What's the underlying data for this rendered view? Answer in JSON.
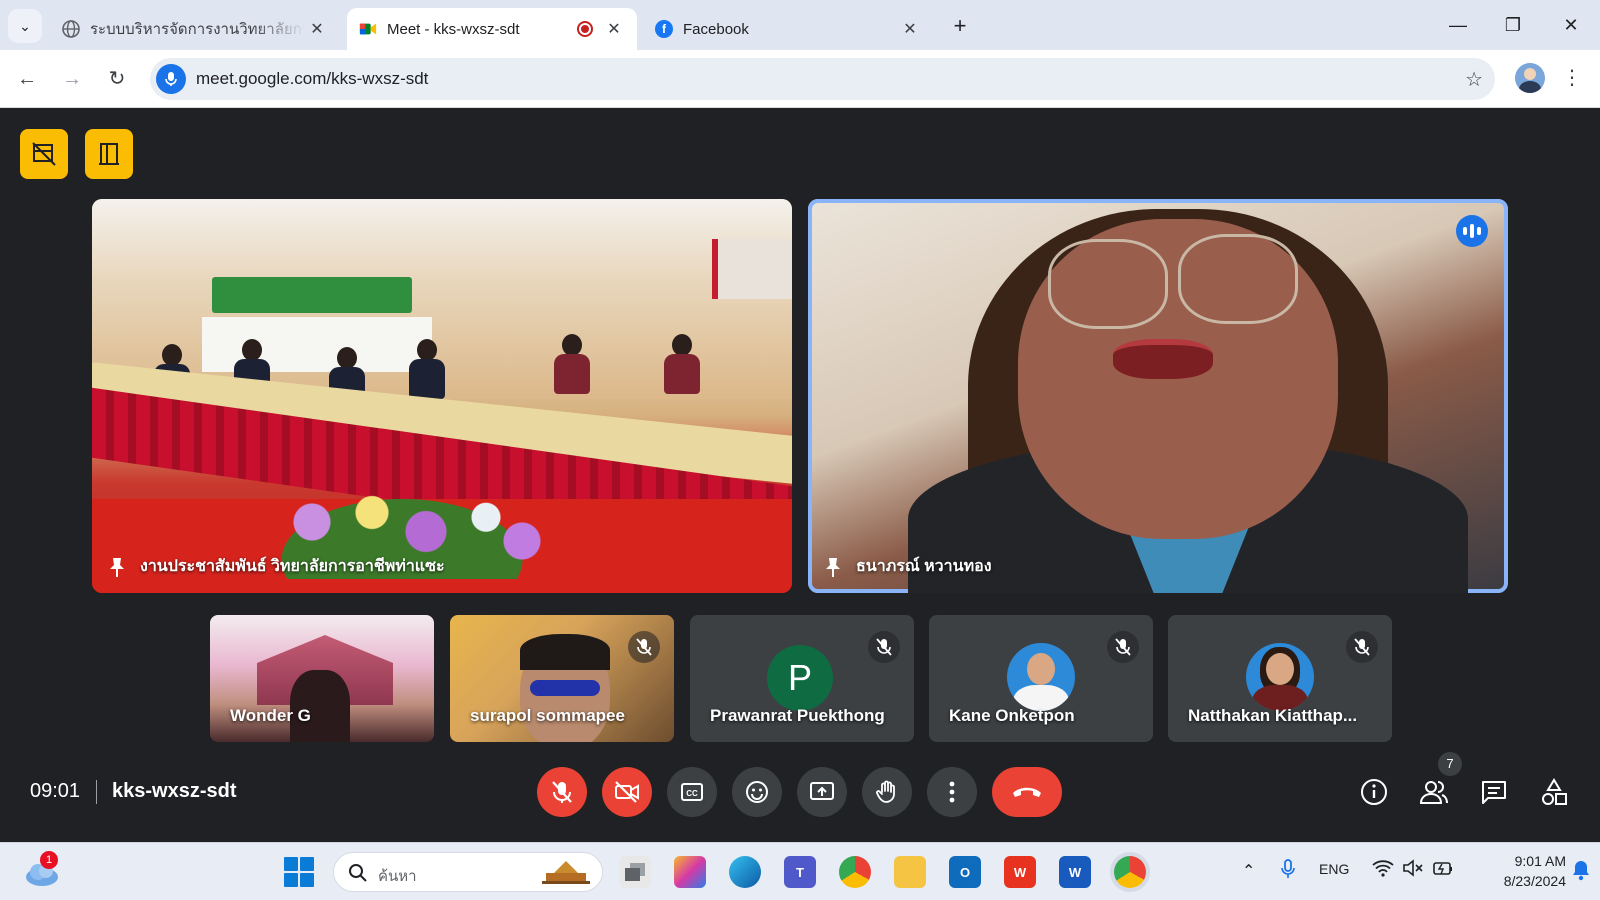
{
  "browser": {
    "tabs": [
      {
        "title": "ระบบบริหารจัดการงานวิทยาลัยการอาชีพท่าแซะ",
        "active": false
      },
      {
        "title": "Meet - kks-wxsz-sdt",
        "active": true
      },
      {
        "title": "Facebook",
        "active": false
      }
    ],
    "url": "meet.google.com/kks-wxsz-sdt"
  },
  "meet": {
    "main_tiles": [
      {
        "name": "งานประชาสัมพันธ์ วิทยาลัยการอาชีพท่าแซะ",
        "speaking": false
      },
      {
        "name": "ธนาภรณ์ หวานทอง",
        "speaking": true
      }
    ],
    "participants": [
      {
        "name": "Wonder G",
        "muted": false,
        "avatar": "video"
      },
      {
        "name": "surapol sommapee",
        "muted": true,
        "avatar": "video"
      },
      {
        "name": "Prawanrat Puekthong",
        "muted": true,
        "avatar": "letter",
        "initial": "P",
        "color": "#0f6b42"
      },
      {
        "name": "Kane Onketpon",
        "muted": true,
        "avatar": "photo"
      },
      {
        "name": "Natthakan Kiatthap...",
        "muted": true,
        "avatar": "photo"
      }
    ],
    "time": "09:01",
    "code": "kks-wxsz-sdt",
    "people_count": "7",
    "colors": {
      "end_call": "#ea4335",
      "accent": "#1a73e8",
      "highlight": "#fbbc04"
    }
  },
  "taskbar": {
    "weather_badge": "1",
    "search_placeholder": "ค้นหา",
    "language": "ENG",
    "time": "9:01 AM",
    "date": "8/23/2024"
  }
}
